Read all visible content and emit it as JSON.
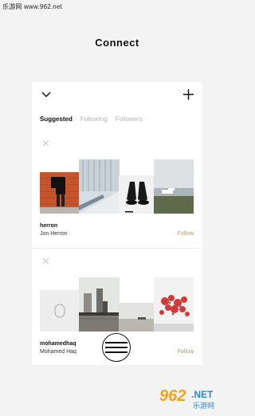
{
  "watermark": {
    "top_left": "乐游网 www.962.net",
    "brand_number": "962",
    "brand_domain": ".NET",
    "brand_cn": "乐游网"
  },
  "page": {
    "title": "Connect"
  },
  "header": {
    "back_icon": "chevron-down-icon",
    "add_icon": "plus-icon"
  },
  "tabs": [
    {
      "label": "Suggested",
      "active": true
    },
    {
      "label": "Following",
      "active": false
    },
    {
      "label": "Followers",
      "active": false
    }
  ],
  "suggestions": [
    {
      "username": "herron",
      "full_name": "Jon Herron",
      "follow_label": "Follow",
      "dismiss_icon": "close-icon"
    },
    {
      "username": "mohamedhaq",
      "full_name": "Mohamed Haq",
      "follow_label": "Follow",
      "dismiss_icon": "close-icon"
    }
  ],
  "fab": {
    "icon": "menu-lines-icon"
  },
  "colors": {
    "follow": "#b39a59",
    "background": "#f3f3f3",
    "card": "#ffffff",
    "brand_orange": "#f4a21c",
    "brand_blue": "#2a8ad4"
  }
}
